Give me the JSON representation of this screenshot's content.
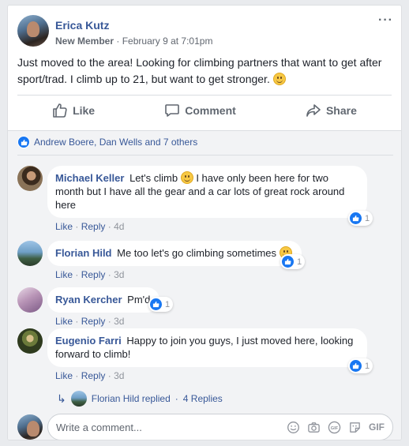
{
  "post": {
    "author": "Erica Kutz",
    "role": "New Member",
    "time": "February 9 at 7:01pm",
    "more": "···",
    "text": "Just moved to the area! Looking for climbing partners that want to get after sport/trad. I climb up to 21, but want to get stronger."
  },
  "actions": {
    "like": "Like",
    "comment": "Comment",
    "share": "Share"
  },
  "reactions": {
    "names": "Andrew Boere, Dan Wells and 7 others"
  },
  "comments": [
    {
      "name": "Michael Keller",
      "text_a": "Let's climb",
      "text_b": "I have only been here for two month but I have all the gear and a car lots of great rock around here",
      "like": "Like",
      "reply": "Reply",
      "time": "4d",
      "reactions": "1"
    },
    {
      "name": "Florian Hild",
      "text_a": "Me too let's go climbing sometimes",
      "like": "Like",
      "reply": "Reply",
      "time": "3d",
      "reactions": "1"
    },
    {
      "name": "Ryan Kercher",
      "text_a": "Pm'd",
      "like": "Like",
      "reply": "Reply",
      "time": "3d",
      "reactions": "1"
    },
    {
      "name": "Eugenio Farri",
      "text_a": "Happy to join you guys, I just moved here, looking forward to climb!",
      "like": "Like",
      "reply": "Reply",
      "time": "3d",
      "reactions": "1"
    }
  ],
  "replies": {
    "who": "Florian Hild replied",
    "count": "4 Replies"
  },
  "composer": {
    "placeholder": "Write a comment...",
    "gif_label": "GIF"
  },
  "colors": {
    "link": "#385898",
    "like_blue": "#1877f2",
    "background": "#e9ebee"
  }
}
